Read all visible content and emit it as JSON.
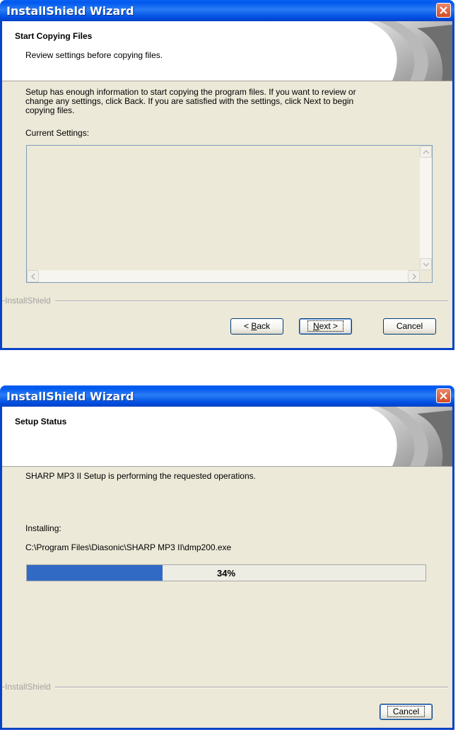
{
  "dialog1": {
    "title": "InstallShield Wizard",
    "header_title": "Start Copying Files",
    "header_subtitle": "Review settings before copying files.",
    "description": [
      "Setup has enough information to start copying the program files.  If you want to review or",
      "change any settings, click Back.  If you are satisfied with the settings, click Next to begin",
      "copying files."
    ],
    "current_settings_label": "Current Settings:",
    "current_settings_value": "",
    "brand": "InstallShield",
    "back_prefix": "< ",
    "back_key": "B",
    "back_rest": "ack",
    "next_key": "N",
    "next_rest": "ext >",
    "cancel_label": "Cancel"
  },
  "dialog2": {
    "title": "InstallShield Wizard",
    "header_title": "Setup Status",
    "status_text": "SHARP MP3 II Setup is performing the requested operations.",
    "installing_label": "Installing:",
    "installing_path": "C:\\Program Files\\Diasonic\\SHARP MP3 II\\dmp200.exe",
    "progress_percent": 34,
    "progress_label": "34%",
    "brand": "InstallShield",
    "cancel_label": "Cancel"
  },
  "colors": {
    "titlebar": "#0058ee",
    "dialog_bg": "#ece9d8",
    "progress_fill": "#316ac5",
    "close_button": "#d34a24"
  },
  "icons": [
    "close-icon",
    "scroll-up-icon",
    "scroll-down-icon",
    "scroll-left-icon",
    "scroll-right-icon",
    "header-swirl-graphic"
  ]
}
